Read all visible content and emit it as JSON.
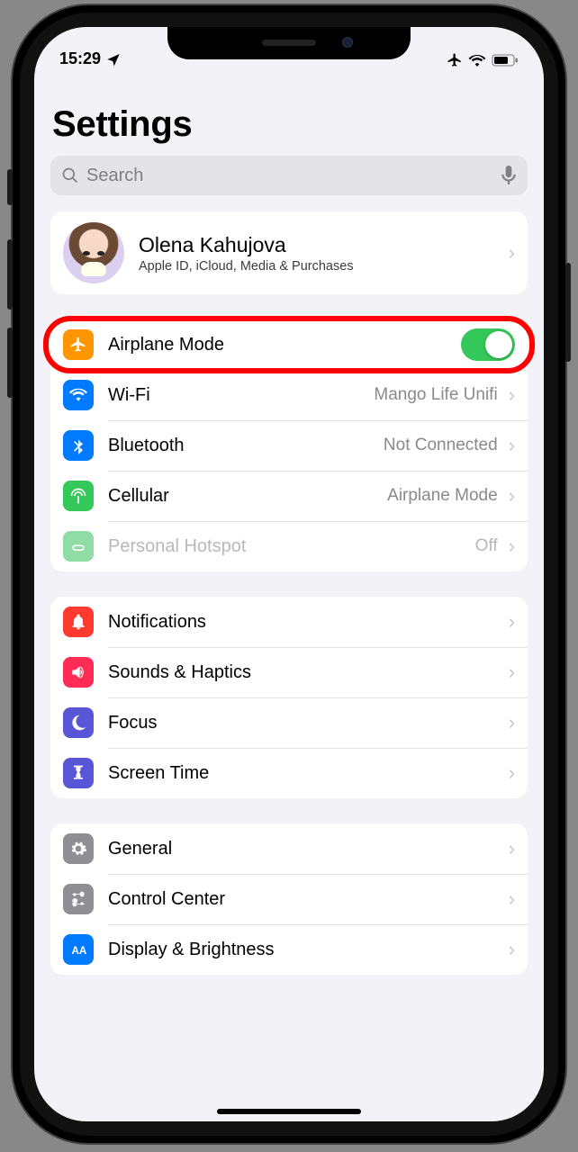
{
  "status": {
    "time": "15:29"
  },
  "header": {
    "title": "Settings"
  },
  "search": {
    "placeholder": "Search"
  },
  "profile": {
    "name": "Olena Kahujova",
    "subtitle": "Apple ID, iCloud, Media & Purchases"
  },
  "conn": {
    "airplane": {
      "label": "Airplane Mode",
      "on": true
    },
    "wifi": {
      "label": "Wi-Fi",
      "detail": "Mango Life Unifi"
    },
    "bt": {
      "label": "Bluetooth",
      "detail": "Not Connected"
    },
    "cell": {
      "label": "Cellular",
      "detail": "Airplane Mode"
    },
    "hotspot": {
      "label": "Personal Hotspot",
      "detail": "Off"
    }
  },
  "sys": {
    "notif": {
      "label": "Notifications"
    },
    "sounds": {
      "label": "Sounds & Haptics"
    },
    "focus": {
      "label": "Focus"
    },
    "screen": {
      "label": "Screen Time"
    }
  },
  "gen": {
    "general": {
      "label": "General"
    },
    "cc": {
      "label": "Control Center"
    },
    "display": {
      "label": "Display & Brightness"
    }
  }
}
